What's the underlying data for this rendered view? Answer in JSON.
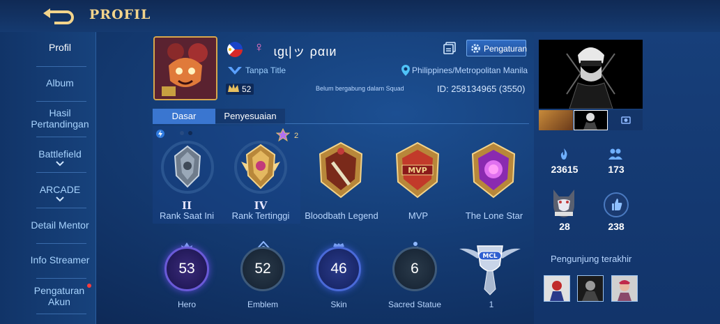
{
  "header": {
    "title": "PROFIL"
  },
  "sidebar": {
    "items": [
      {
        "label": "Profil"
      },
      {
        "label": "Album"
      },
      {
        "label": "Hasil Pertandingan"
      },
      {
        "label": "Battlefield"
      },
      {
        "label": "ARCADE"
      },
      {
        "label": "Detail Mentor"
      },
      {
        "label": "Info Streamer"
      },
      {
        "label": "Pengaturan Akun"
      }
    ]
  },
  "profile": {
    "username": "ɩɡɩ|ッ ραιи",
    "title": "Tanpa Title",
    "level": "52",
    "squad_status": "Belum bergabung dalam Squad",
    "location": "Philippines/Metropolitan Manila",
    "id": "ID: 258134965 (3550)",
    "settings_label": "Pengaturan"
  },
  "tabs": [
    {
      "label": "Dasar"
    },
    {
      "label": "Penyesuaian"
    }
  ],
  "ranks": {
    "current_label": "Rank Saat Ini",
    "current_tier": "II",
    "highest_label": "Rank Tertinggi",
    "highest_tier": "IV",
    "highest_stars": "2"
  },
  "badges": [
    {
      "label": "Bloodbath Legend"
    },
    {
      "label": "MVP"
    },
    {
      "label": "The Lone Star"
    }
  ],
  "stats": [
    {
      "label": "Hero",
      "value": "53"
    },
    {
      "label": "Emblem",
      "value": "52"
    },
    {
      "label": "Skin",
      "value": "46"
    },
    {
      "label": "Sacred Statue",
      "value": "6"
    },
    {
      "label": "",
      "value": "1"
    }
  ],
  "right": {
    "popularity": "23615",
    "friends": "173",
    "mentor_count": "28",
    "likes": "238",
    "visitors_title": "Pengunjung terakhir"
  }
}
